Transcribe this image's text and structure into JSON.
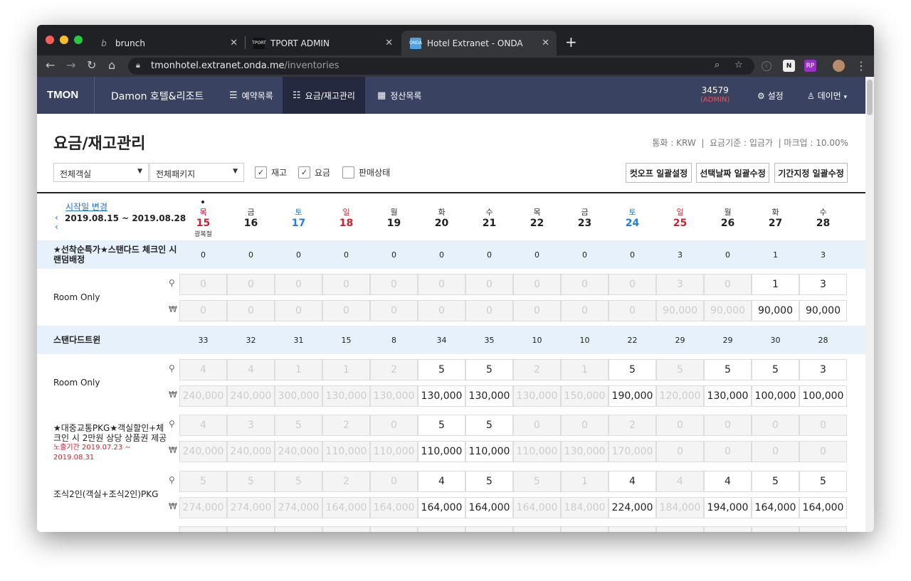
{
  "browser": {
    "tabs": [
      {
        "title": "brunch",
        "active": false
      },
      {
        "title": "TPORT ADMIN",
        "active": false
      },
      {
        "title": "Hotel Extranet - ONDA",
        "active": true
      }
    ],
    "url_host": "tmonhotel.extranet.onda.me",
    "url_path": "/inventories"
  },
  "header": {
    "logo": "TMON",
    "hotel_name": "Damon 호텔&리조트",
    "nav": [
      {
        "label": "예약목록",
        "icon": "list-icon",
        "active": false
      },
      {
        "label": "요금/재고관리",
        "icon": "rate-icon",
        "active": true
      },
      {
        "label": "정산목록",
        "icon": "calculator-icon",
        "active": false
      }
    ],
    "account_id": "34579",
    "account_role": "(ADMIN)",
    "settings_label": "설정",
    "user_label": "데이먼"
  },
  "page": {
    "title": "요금/재고관리",
    "info": "통화 : KRW  |  요금기준 : 입금가  | 마크업 : 10.00%",
    "room_select": "전체객실",
    "package_select": "전체패키지",
    "check_stock": "재고",
    "check_rate": "요금",
    "check_status": "판매상태",
    "btn_cutoff": "컷오프 일괄설정",
    "btn_selected": "선택날짜 일괄수정",
    "btn_period": "기간지정 일괄수정",
    "change_start": "시작일 변경",
    "date_range": "2019.08.15 ~ 2019.08.28"
  },
  "dates": [
    {
      "dow": "목",
      "day": "15",
      "type": "red",
      "holiday": "광복절",
      "today": true
    },
    {
      "dow": "금",
      "day": "16",
      "type": ""
    },
    {
      "dow": "토",
      "day": "17",
      "type": "sat"
    },
    {
      "dow": "일",
      "day": "18",
      "type": "red"
    },
    {
      "dow": "월",
      "day": "19",
      "type": ""
    },
    {
      "dow": "화",
      "day": "20",
      "type": ""
    },
    {
      "dow": "수",
      "day": "21",
      "type": ""
    },
    {
      "dow": "목",
      "day": "22",
      "type": ""
    },
    {
      "dow": "금",
      "day": "23",
      "type": ""
    },
    {
      "dow": "토",
      "day": "24",
      "type": "sat"
    },
    {
      "dow": "일",
      "day": "25",
      "type": "red"
    },
    {
      "dow": "월",
      "day": "26",
      "type": ""
    },
    {
      "dow": "화",
      "day": "27",
      "type": ""
    },
    {
      "dow": "수",
      "day": "28",
      "type": ""
    }
  ],
  "rooms": [
    {
      "name": "★선착순특가★스탠다드 체크인 시 랜덤배정",
      "counts": [
        "0",
        "0",
        "0",
        "0",
        "0",
        "0",
        "0",
        "0",
        "0",
        "0",
        "3",
        "0",
        "1",
        "3"
      ],
      "plans": [
        {
          "name": "Room Only",
          "expose": "",
          "stock": [
            "0",
            "0",
            "0",
            "0",
            "0",
            "0",
            "0",
            "0",
            "0",
            "0",
            "3",
            "0",
            "1",
            "3"
          ],
          "stock_on": [
            0,
            0,
            0,
            0,
            0,
            0,
            0,
            0,
            0,
            0,
            0,
            0,
            1,
            1
          ],
          "rate": [
            "0",
            "0",
            "0",
            "0",
            "0",
            "0",
            "0",
            "0",
            "0",
            "0",
            "90,000",
            "90,000",
            "90,000",
            "90,000"
          ],
          "rate_on": [
            0,
            0,
            0,
            0,
            0,
            0,
            0,
            0,
            0,
            0,
            0,
            0,
            1,
            1
          ]
        }
      ]
    },
    {
      "name": "스탠다드트윈",
      "counts": [
        "33",
        "32",
        "31",
        "15",
        "8",
        "34",
        "35",
        "10",
        "10",
        "22",
        "29",
        "29",
        "30",
        "28"
      ],
      "plans": [
        {
          "name": "Room Only",
          "expose": "",
          "stock": [
            "4",
            "4",
            "1",
            "1",
            "2",
            "5",
            "5",
            "2",
            "1",
            "5",
            "5",
            "5",
            "5",
            "3"
          ],
          "stock_on": [
            0,
            0,
            0,
            0,
            0,
            1,
            1,
            0,
            0,
            1,
            0,
            1,
            1,
            1
          ],
          "rate": [
            "240,000",
            "240,000",
            "300,000",
            "130,000",
            "130,000",
            "130,000",
            "130,000",
            "130,000",
            "150,000",
            "190,000",
            "120,000",
            "130,000",
            "100,000",
            "100,000"
          ],
          "rate_on": [
            0,
            0,
            0,
            0,
            0,
            1,
            1,
            0,
            0,
            1,
            0,
            1,
            1,
            1
          ]
        },
        {
          "name": "★대중교통PKG★객실할인+체크인 시 2만원 상당 상품권 제공",
          "expose": "노출기간 2019.07.23 ~ 2019.08.31",
          "stock": [
            "4",
            "3",
            "5",
            "2",
            "0",
            "5",
            "5",
            "0",
            "0",
            "2",
            "0",
            "0",
            "0",
            "0"
          ],
          "stock_on": [
            0,
            0,
            0,
            0,
            0,
            1,
            1,
            0,
            0,
            0,
            0,
            0,
            0,
            0
          ],
          "rate": [
            "240,000",
            "240,000",
            "240,000",
            "110,000",
            "110,000",
            "110,000",
            "110,000",
            "110,000",
            "130,000",
            "170,000",
            "0",
            "0",
            "0",
            "0"
          ],
          "rate_on": [
            0,
            0,
            0,
            0,
            0,
            1,
            1,
            0,
            0,
            0,
            0,
            0,
            0,
            0
          ]
        },
        {
          "name": "조식2인(객실+조식2인)PKG",
          "expose": "",
          "stock": [
            "5",
            "5",
            "5",
            "2",
            "0",
            "4",
            "5",
            "5",
            "1",
            "4",
            "4",
            "4",
            "5",
            "5"
          ],
          "stock_on": [
            0,
            0,
            0,
            0,
            0,
            1,
            1,
            0,
            0,
            1,
            0,
            1,
            1,
            1
          ],
          "rate": [
            "274,000",
            "274,000",
            "274,000",
            "164,000",
            "164,000",
            "164,000",
            "164,000",
            "164,000",
            "184,000",
            "224,000",
            "184,000",
            "194,000",
            "164,000",
            "164,000"
          ],
          "rate_on": [
            0,
            0,
            0,
            0,
            0,
            1,
            1,
            0,
            0,
            1,
            0,
            1,
            1,
            1
          ]
        }
      ]
    }
  ],
  "icons": {
    "stock": "key-icon",
    "rate": "won-icon"
  },
  "colors": {
    "header_bg": "#394361",
    "active_nav": "#232a3f",
    "room_bar": "#e6f1fb",
    "saturday": "#1e7fd8",
    "holiday": "#d0202f"
  }
}
